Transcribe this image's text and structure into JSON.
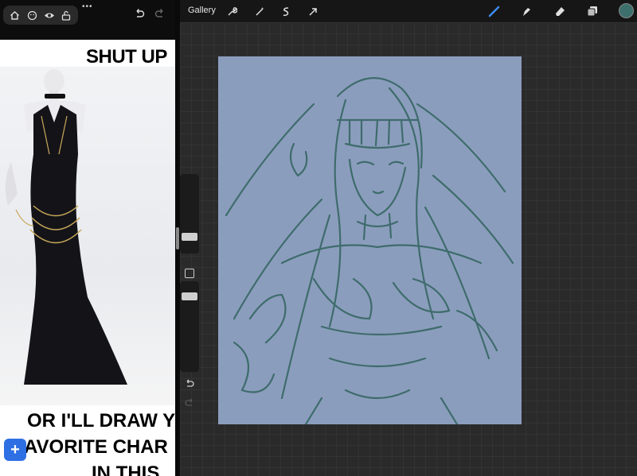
{
  "reference_panel": {
    "meme_text_top": "SHUT UP",
    "meme_text_bottom_1": "OR I'LL DRAW Y",
    "meme_text_bottom_2": "AVORITE CHAR",
    "meme_text_bottom_3": "IN THIS",
    "more_menu": "•••",
    "add_button_label": "+"
  },
  "app": {
    "gallery_label": "Gallery",
    "current_color": "#3d6f6d",
    "canvas_color": "#8b9dbd",
    "sketch_color": "#3a6a68"
  }
}
